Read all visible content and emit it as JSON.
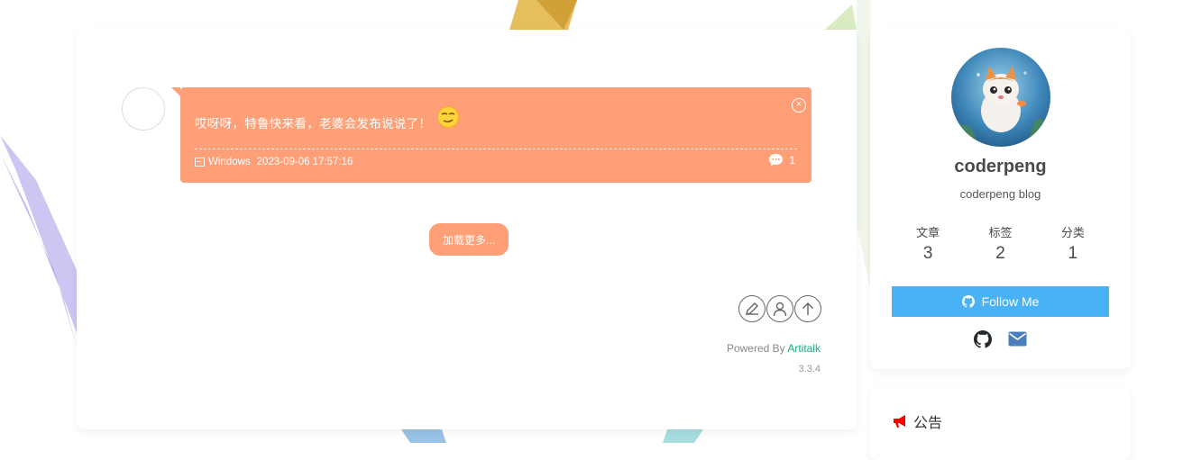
{
  "talk": {
    "content": "哎呀呀，特鲁快来看，老婆会发布说说了！",
    "emoji": "smirk-face",
    "os": "Windows",
    "date": "2023-09-06 17:57:16",
    "comment_count": "1"
  },
  "load_more_label": "加载更多...",
  "footer": {
    "powered_prefix": "Powered By ",
    "powered_link": "Artitalk",
    "version": "3.3.4"
  },
  "profile": {
    "name": "coderpeng",
    "description": "coderpeng blog",
    "stats": [
      {
        "label": "文章",
        "value": "3"
      },
      {
        "label": "标签",
        "value": "2"
      },
      {
        "label": "分类",
        "value": "1"
      }
    ],
    "follow_label": "Follow Me",
    "socials": [
      "github-icon",
      "envelope-icon"
    ]
  },
  "notice": {
    "title": "公告",
    "icon": "bullhorn-icon"
  },
  "colors": {
    "accent": "#ff9f78",
    "follow": "#49b1f5",
    "link": "#19a982",
    "notice_icon": "#ff0000"
  }
}
